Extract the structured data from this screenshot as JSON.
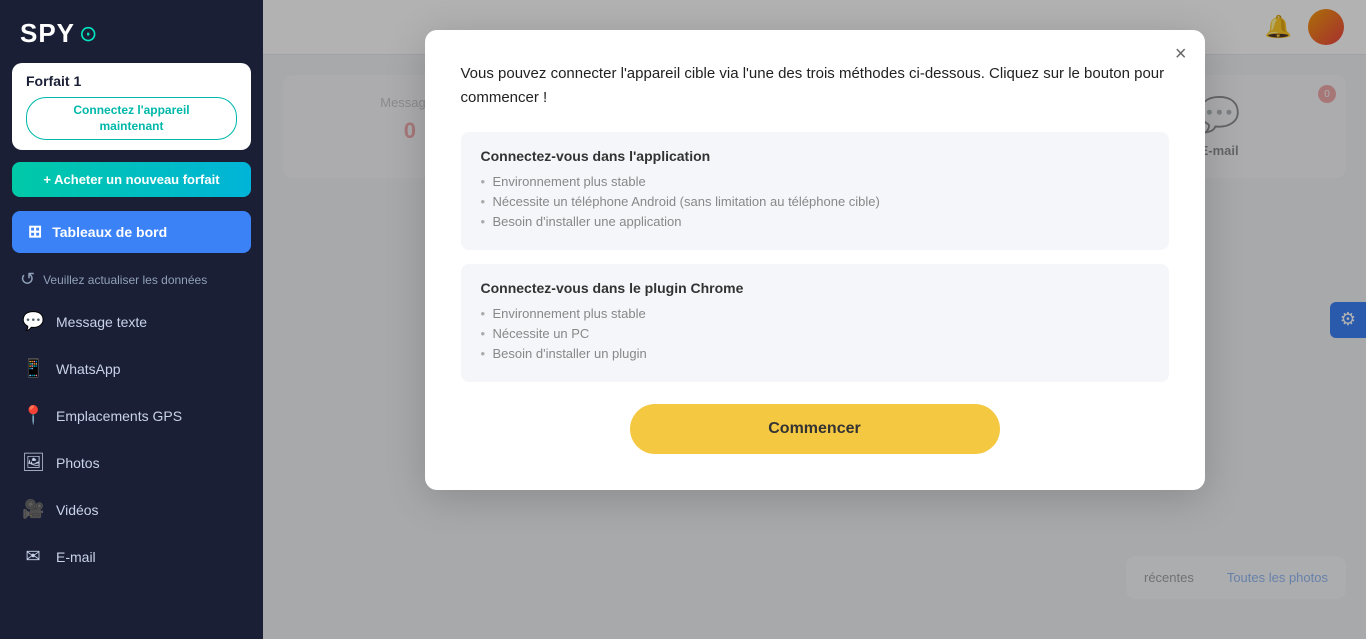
{
  "sidebar": {
    "logo": "SPY",
    "logo_icon": "⊙",
    "forfait_label": "Forfait 1",
    "connect_btn_label": "Connectez l'appareil\nmaintenant",
    "new_forfait_label": "+ Acheter un nouveau forfait",
    "tableaux_label": "Tableaux de bord",
    "refresh_label": "Veuillez actualiser les données",
    "nav_items": [
      {
        "id": "message-texte",
        "label": "Message texte",
        "icon": "💬"
      },
      {
        "id": "whatsapp",
        "label": "WhatsApp",
        "icon": "📱"
      },
      {
        "id": "emplacements-gps",
        "label": "Emplacements GPS",
        "icon": "📍"
      },
      {
        "id": "photos",
        "label": "Photos",
        "icon": "🖼"
      },
      {
        "id": "videos",
        "label": "Vidéos",
        "icon": "🎥"
      },
      {
        "id": "email",
        "label": "E-mail",
        "icon": "✉"
      }
    ]
  },
  "topbar": {
    "bell_label": "notifications",
    "avatar_label": "user avatar"
  },
  "modal": {
    "intro": "Vous pouvez connecter l'appareil cible via l'une des trois méthodes ci-dessous. Cliquez sur le bouton pour commencer !",
    "close_label": "×",
    "section1": {
      "title": "Connectez-vous dans l'application",
      "points": [
        "Environnement plus stable",
        "Nécessite un téléphone Android (sans limitation au téléphone cible)",
        "Besoin d'installer une application"
      ]
    },
    "section2": {
      "title": "Connectez-vous dans le plugin Chrome",
      "points": [
        "Environnement plus stable",
        "Nécessite un PC",
        "Besoin d'installer un plugin"
      ]
    },
    "start_btn_label": "Commencer"
  },
  "right_panel": {
    "email_label": "E-mail",
    "email_badge": "0",
    "photos_recent_label": "récentes",
    "toutes_photos_label": "Toutes les photos"
  },
  "settings_gear_icon": "⚙"
}
